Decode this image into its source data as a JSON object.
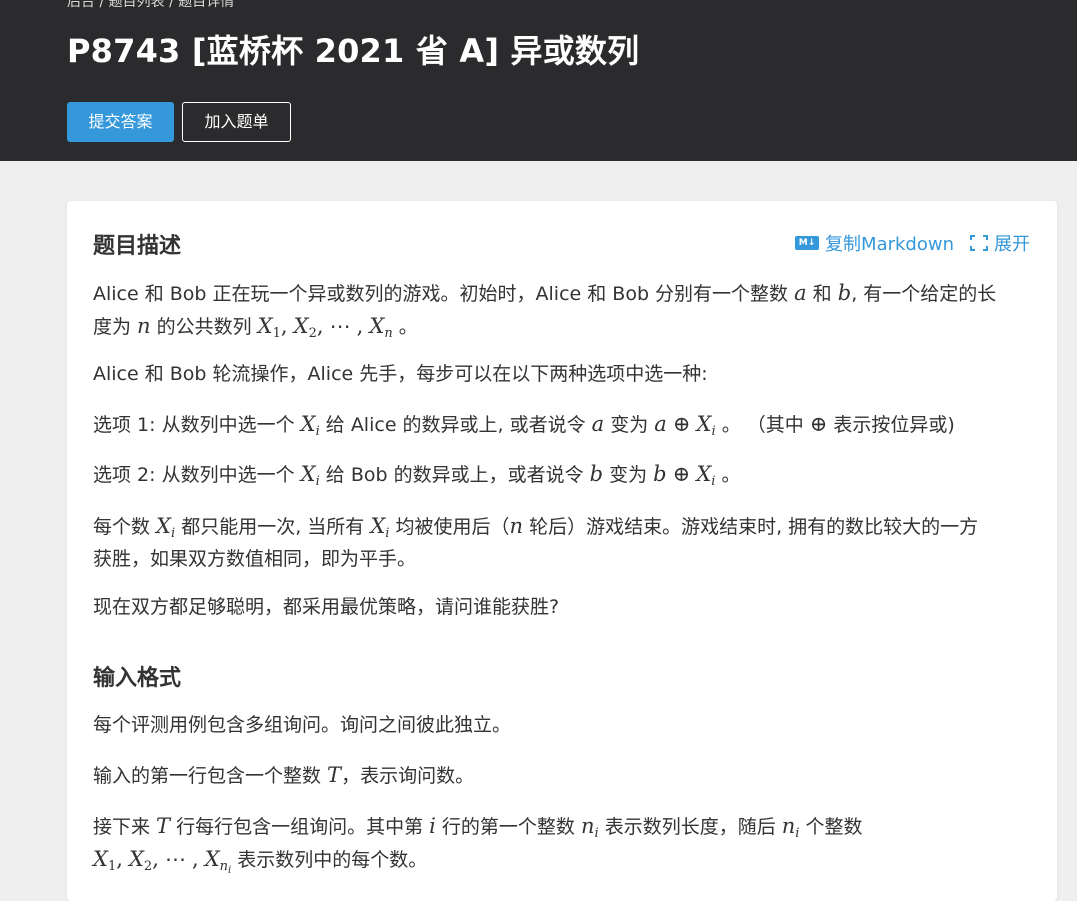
{
  "header": {
    "breadcrumb": "后台 / 题目列表 / 题目详情",
    "title": "P8743 [蓝桥杯 2021 省 A] 异或数列",
    "submit_label": "提交答案",
    "add_label": "加入题单"
  },
  "toolbar": {
    "copy_markdown": "复制Markdown",
    "expand": "展开",
    "md_icon_text": "M↓"
  },
  "description": {
    "heading": "题目描述",
    "p1": {
      "t1": "Alice 和 Bob 正在玩一个异或数列的游戏。初始时，Alice 和 Bob 分别有一个整数 ",
      "a": "a",
      "t2": " 和 ",
      "b": "b",
      "t3": ", 有一个给定的长",
      "t4": "度为 ",
      "n": "n",
      "t5": " 的公共数列 ",
      "seq": "X₁, X₂, ⋯ , Xₙ",
      "t6": " 。"
    },
    "p2": "Alice 和 Bob 轮流操作，Alice 先手，每步可以在以下两种选项中选一种:",
    "p3": {
      "t1": "选项 1: 从数列中选一个 ",
      "t2": " 给 Alice 的数异或上, 或者说令 ",
      "t3": " 变为 ",
      "t4": " 。 （其中 ",
      "t5": " 表示按位异或)"
    },
    "p4": {
      "t1": "选项 2: 从数列中选一个 ",
      "t2": " 给 Bob 的数异或上，或者说令 ",
      "t3": " 变为 ",
      "t4": " 。"
    },
    "p5": {
      "t1": "每个数 ",
      "t2": " 都只能用一次, 当所有 ",
      "t3": " 均被使用后（",
      "t4": " 轮后）游戏结束。游戏结束时, 拥有的数比较大的一方",
      "t5": "获胜，如果双方数值相同，即为平手。"
    },
    "p6": "现在双方都足够聪明，都采用最优策略，请问谁能获胜?"
  },
  "input_format": {
    "heading": "输入格式",
    "p1": "每个评测用例包含多组询问。询问之间彼此独立。",
    "p2": {
      "t1": "输入的第一行包含一个整数 ",
      "t2": "，表示询问数。"
    },
    "p3": {
      "t1": "接下来 ",
      "t2": " 行每行包含一组询问。其中第 ",
      "t3": " 行的第一个整数 ",
      "t4": " 表示数列长度，随后 ",
      "t5": " 个整数",
      "t6": " 表示数列中的每个数。"
    }
  },
  "math": {
    "X": "X",
    "i": "i",
    "a": "a",
    "b": "b",
    "n": "n",
    "T": "T",
    "oplus": "⊕",
    "one": "1",
    "two": "2",
    "dots": "⋯",
    "comma": ",",
    "sub_n": "n"
  }
}
